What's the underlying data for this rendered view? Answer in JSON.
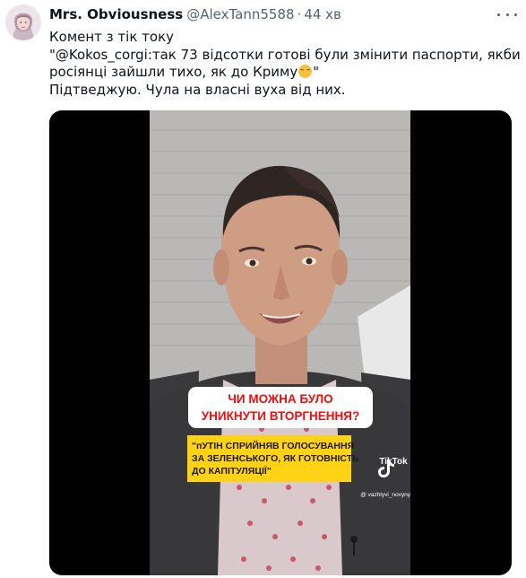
{
  "tweet": {
    "display_name": "Mrs. Obviousness",
    "handle": "@AlexTann5588",
    "separator": "·",
    "time": "44 хв",
    "more_icon": "more-horizontal-icon",
    "text_lines": [
      "Комент з тік току",
      "\"@Kokos_corgi:так 73 відсотки готові були змінити паспорти, якби",
      "росіянці зайшли тихо, як до Криму",
      "\"",
      "Підтведжую. Чула на власні вуха від них."
    ],
    "emoji": "smirking-face"
  },
  "video": {
    "question_lines": [
      "ЧИ МОЖНА БУЛО",
      "УНИКНУТИ ВТОРГНЕННЯ?"
    ],
    "caption_lines": [
      "\"пУТІН СПРИЙНЯВ ГОЛОСУВАННЯ",
      "ЗА ЗЕЛЕНСЬКОГО, ЯК ГОТОВНІСТЬ",
      "ДО КАПІТУЛЯЦІЇ\""
    ],
    "tiktok_label": "TikTok",
    "tiktok_user": "@ vazhlyvi_novyny",
    "colors": {
      "question_text": "#f20d0d",
      "caption_bg": "#ffd214",
      "letterbox": "#000000"
    }
  }
}
